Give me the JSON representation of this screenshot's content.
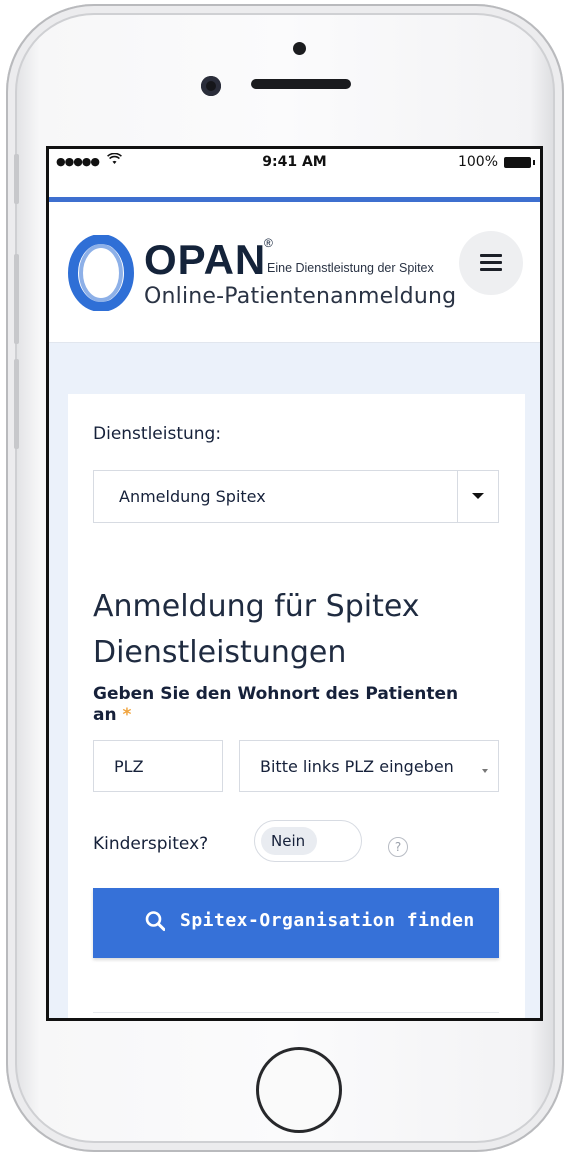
{
  "status_bar": {
    "signal": "●●●●●",
    "time": "9:41 AM",
    "battery": "100%"
  },
  "header": {
    "brand": "OPAN",
    "registered": "®",
    "tagline": "Eine Dienstleistung der Spitex",
    "subtitle": "Online-Patientenanmeldung"
  },
  "form": {
    "service_label": "Dienstleistung:",
    "service_value": "Anmeldung Spitex",
    "heading": "Anmeldung für Spitex Dienstleistungen",
    "location_label": "Geben Sie den Wohnort des Patienten an",
    "required_marker": "*",
    "plz_placeholder": "PLZ",
    "ort_placeholder": "Bitte links PLZ eingeben",
    "kinder_label": "Kinderspitex?",
    "kinder_value": "Nein",
    "help": "?",
    "submit_label": "Spitex-Organisation finden"
  },
  "colors": {
    "accent": "#3671d8",
    "logo_blue": "#2f6fd6",
    "required": "#f0a33c"
  },
  "icons": [
    "wifi-icon",
    "battery-icon",
    "menu-icon",
    "chevron-down-icon",
    "help-icon",
    "search-icon"
  ]
}
